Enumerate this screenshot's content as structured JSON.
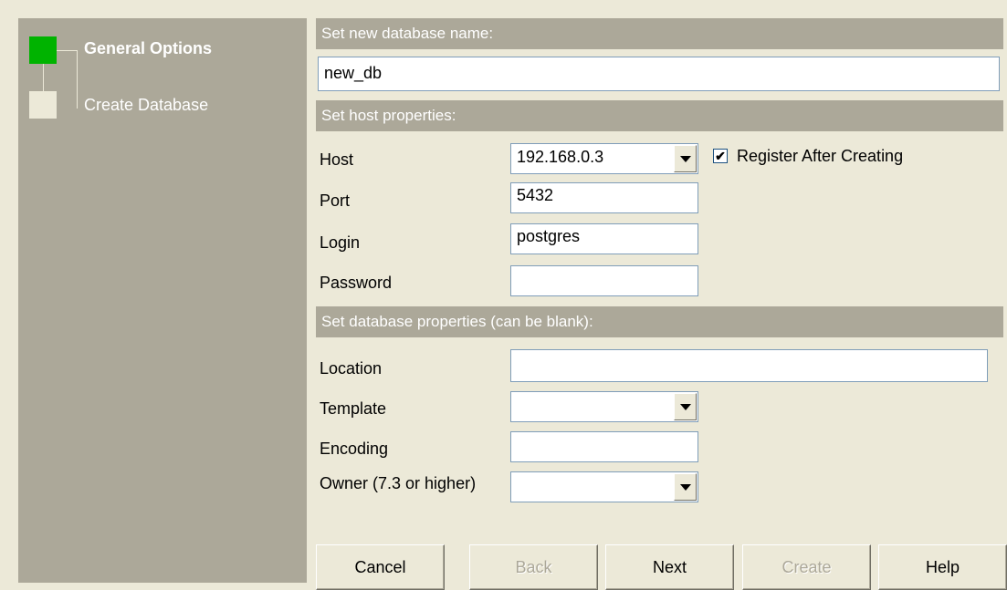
{
  "steps": [
    {
      "label": "General Options",
      "active": true
    },
    {
      "label": "Create Database",
      "active": false
    }
  ],
  "sections": {
    "db_name": "Set new database name:",
    "host": "Set host properties:",
    "db_props": "Set database properties (can be blank):"
  },
  "db_name": {
    "value": "new_db"
  },
  "host_props": {
    "host_label": "Host",
    "host_value": "192.168.0.3",
    "register_label": "Register After Creating",
    "register_checked": true,
    "port_label": "Port",
    "port_value": "5432",
    "login_label": "Login",
    "login_value": "postgres",
    "password_label": "Password",
    "password_value": ""
  },
  "db_props": {
    "location_label": "Location",
    "location_value": "",
    "template_label": "Template",
    "template_value": "",
    "encoding_label": "Encoding",
    "encoding_value": "",
    "owner_label": "Owner (7.3 or higher)",
    "owner_value": ""
  },
  "buttons": {
    "cancel": "Cancel",
    "back": "Back",
    "next": "Next",
    "create": "Create",
    "help": "Help"
  },
  "colors": {
    "step_active": "#00b300",
    "step_inactive": "#ece9d8",
    "sidebar": "#aca899"
  },
  "icons": {
    "checkmark": "✔",
    "dropdown": "chevron-down-icon"
  }
}
